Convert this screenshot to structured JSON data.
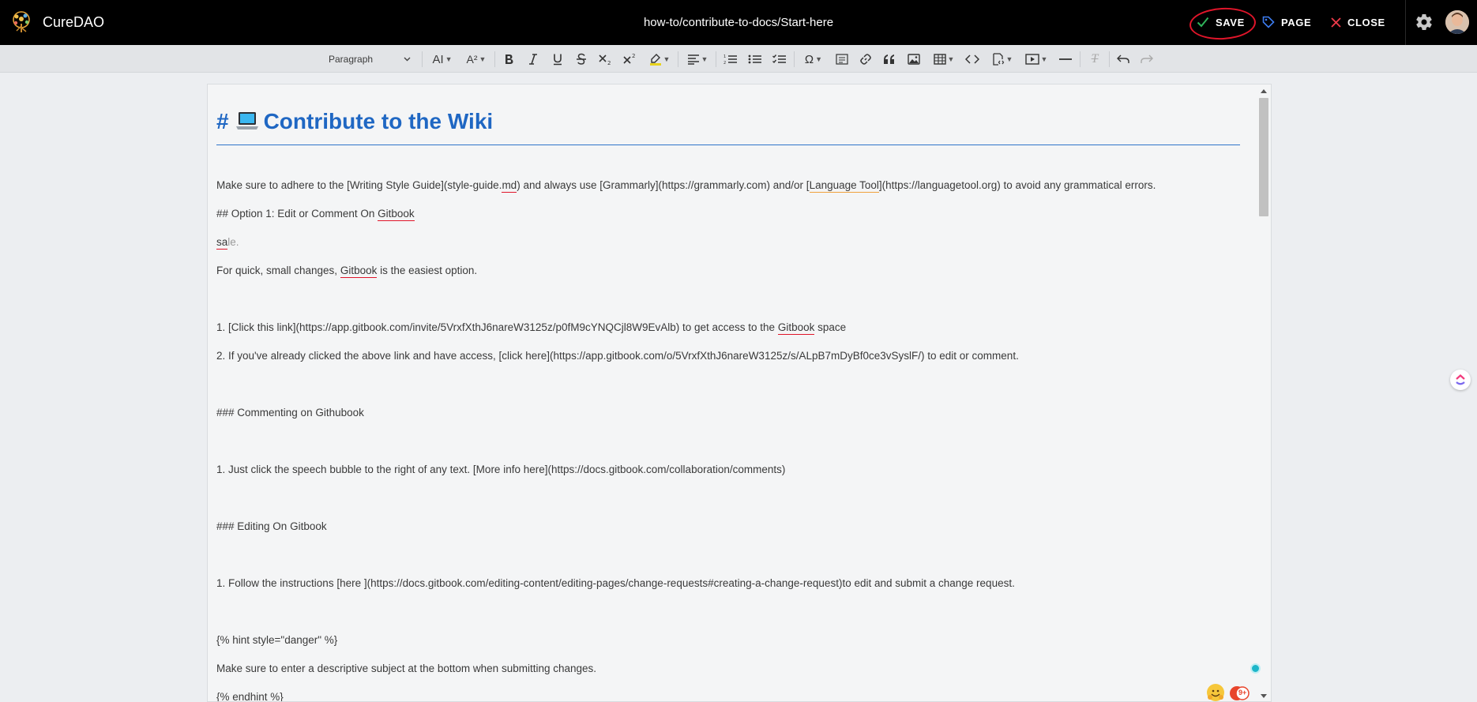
{
  "header": {
    "brand": "CureDAO",
    "page_path": "how-to/contribute-to-docs/Start-here",
    "save_label": "SAVE",
    "page_label": "PAGE",
    "close_label": "CLOSE"
  },
  "toolbar": {
    "paragraph_style": "Paragraph",
    "font_size_icon": "AI",
    "font_format_icon": "A²"
  },
  "document": {
    "heading_hash": "#",
    "heading_text": "Contribute to the Wiki",
    "line1_a": "Make sure to adhere to the [Writing Style Guide](style-guide.",
    "line1_b": "md",
    "line1_c": ") and always use [Grammarly](https://grammarly.com) and/or [",
    "line1_d": "Language Tool",
    "line1_e": "](https://languagetool.org) to avoid any grammatical errors.",
    "line2_a": "## Option 1: Edit or Comment On ",
    "line2_b": "Gitbook",
    "line3_a": "sa",
    "line3_b": "le.",
    "line4_a": "For quick, small changes, ",
    "line4_b": "Gitbook",
    "line4_c": " is the easiest option.",
    "line5_a": "1. [Click this link](https://app.gitbook.com/invite/5VrxfXthJ6nareW3125z/p0fM9cYNQCjl8W9EvAlb) to get access to the ",
    "line5_b": "Gitbook",
    "line5_c": " space",
    "line6": "2. If you've already clicked the above link and have access, [click here](https://app.gitbook.com/o/5VrxfXthJ6nareW3125z/s/ALpB7mDyBf0ce3vSyslF/) to edit or comment.",
    "line7": "### Commenting on Githubook",
    "line8": "1. Just click the speech bubble to the right of any text. [More info here](https://docs.gitbook.com/collaboration/comments)",
    "line9": "### Editing On Gitbook",
    "line10": "1. Follow the instructions [here ](https://docs.gitbook.com/editing-content/editing-pages/change-requests#creating-a-change-request)to edit and submit a change request.",
    "line11": "{% hint style=\"danger\" %}",
    "line12": "Make sure to enter a descriptive subject at the bottom when submitting changes.",
    "line13": "{% endhint %}"
  },
  "badges": {
    "notification_count": "9+"
  },
  "colors": {
    "header_bg": "#000000",
    "heading_blue": "#1f67c3",
    "spell_red": "#e0152a",
    "grammar_orange": "#f0a23c",
    "save_check_green": "#2fb35a",
    "page_tag_blue": "#3d7cf0",
    "close_x_red": "#ef3b4a"
  },
  "icons": [
    "curedao-logo-icon",
    "check-icon",
    "tag-icon",
    "close-icon",
    "gear-icon",
    "avatar",
    "chevron-down-icon",
    "bold-icon",
    "italic-icon",
    "underline-icon",
    "strikethrough-icon",
    "subscript-icon",
    "superscript-icon",
    "highlight-icon",
    "align-icon",
    "numbered-list-icon",
    "bulleted-list-icon",
    "todo-list-icon",
    "special-characters-icon",
    "source-icon",
    "link-icon",
    "quote-icon",
    "image-icon",
    "table-icon",
    "code-icon",
    "html-embed-icon",
    "media-embed-icon",
    "horizontal-line-icon",
    "remove-format-icon",
    "undo-icon",
    "redo-icon",
    "clickup-icon"
  ]
}
